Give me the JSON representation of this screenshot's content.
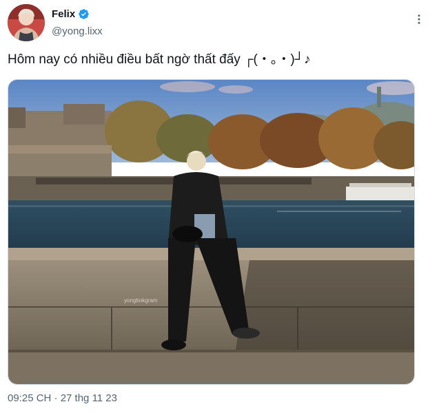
{
  "author": {
    "display_name": "Felix",
    "handle": "@yong.lixx",
    "verified_badge_icon": "verified-badge-icon",
    "accent_color": "#1d9bf0"
  },
  "tweet": {
    "text": "Hôm nay có nhiều điều bất ngờ thất đấy ┌(・。・)┘♪",
    "timestamp": "09:25 CH · 27 thg 11 23"
  },
  "media": {
    "watermark": "yongbokgram"
  },
  "icons": {
    "more": "more-vertical-icon"
  }
}
